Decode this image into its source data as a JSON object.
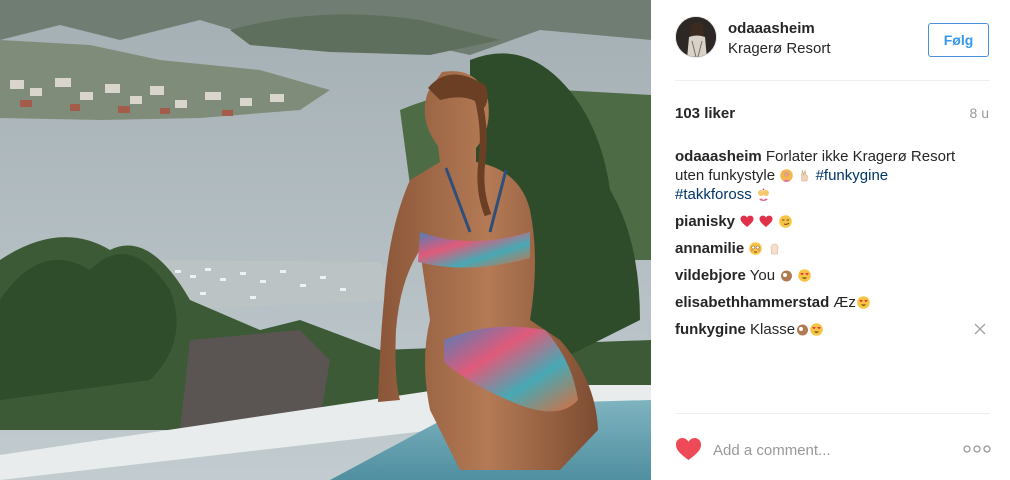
{
  "post": {
    "username": "odaaasheim",
    "location": "Kragerø Resort",
    "follow_label": "Følg",
    "likes": "103 liker",
    "age": "8 u"
  },
  "caption": {
    "username": "odaaasheim",
    "line1": "Forlater ikke Kragerø Resort",
    "line2_text": "uten funkystyle",
    "hashtag1": "#funkygine",
    "hashtag2": "#takkfoross"
  },
  "comments": [
    {
      "username": "pianisky",
      "text": "",
      "emojis": [
        "heart-emoji",
        "heart-emoji",
        "smirk-emoji"
      ]
    },
    {
      "username": "annamilie",
      "text": "",
      "emojis": [
        "flushed-emoji",
        "raised-hand-emoji"
      ]
    },
    {
      "username": "vildebjore",
      "text": "You",
      "emojis": [
        "ok-hand-emoji",
        "heart-eyes-emoji"
      ]
    },
    {
      "username": "elisabethhammerstad",
      "text": "Æz",
      "emojis": [
        "heart-eyes-emoji"
      ]
    },
    {
      "username": "funkygine",
      "text": "Klasse",
      "emojis": [
        "ok-hand-emoji",
        "heart-eyes-emoji"
      ]
    }
  ],
  "footer": {
    "comment_placeholder": "Add a comment..."
  },
  "colors": {
    "link_blue": "#3897f0",
    "hashtag_blue": "#003569",
    "like_red": "#ed4956",
    "text": "#262626",
    "muted": "#999999"
  },
  "icons": {
    "like": "heart-icon",
    "more": "more-dots-icon",
    "remove": "close-icon"
  }
}
